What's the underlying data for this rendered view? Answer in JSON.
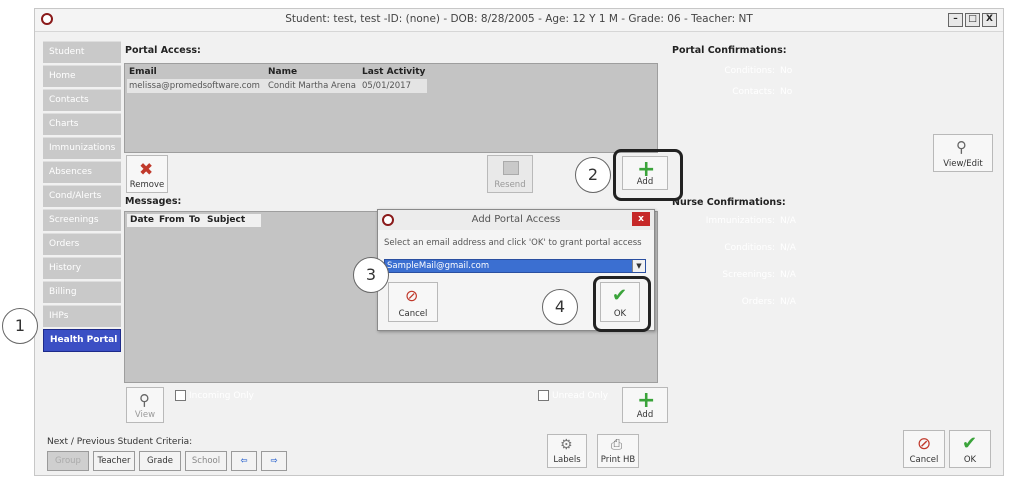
{
  "window": {
    "title": "Student: test, test -ID: (none) - DOB: 8/28/2005 - Age: 12 Y 1 M - Grade: 06 - Teacher: NT",
    "btn_min": "–",
    "btn_max": "□",
    "btn_close": "X"
  },
  "sidebar": {
    "items": [
      "Student",
      "Home",
      "Contacts",
      "Charts",
      "Immunizations",
      "Absences",
      "Cond/Alerts",
      "Screenings",
      "Orders",
      "History",
      "Billing",
      "IHPs",
      "Health Portal"
    ],
    "active_index": 12
  },
  "portal_access": {
    "header": "Portal Access:",
    "columns": [
      "Email",
      "Name",
      "Last Activity"
    ],
    "rows": [
      [
        "melissa@promedsoftware.com",
        "Condit Martha Arena",
        "05/01/2017"
      ]
    ],
    "remove_label": "Remove",
    "resend_label": "Resend",
    "add_label": "Add"
  },
  "messages": {
    "header": "Messages:",
    "columns": [
      "Date",
      "From",
      "To",
      "Subject"
    ],
    "view_label": "View",
    "incoming_only": "Incoming Only",
    "unread_only": "Unread Only",
    "add_label": "Add"
  },
  "portal_confirmations": {
    "header": "Portal Confirmations:",
    "items": [
      {
        "label": "Conditions:",
        "value": "No"
      },
      {
        "label": "Contacts:",
        "value": "No"
      }
    ],
    "view_edit_label": "View/Edit"
  },
  "nurse_confirmations": {
    "header": "Nurse Confirmations:",
    "items": [
      {
        "label": "Immunizations:",
        "value": "N/A"
      },
      {
        "label": "Conditions:",
        "value": "N/A"
      },
      {
        "label": "Screenings:",
        "value": "N/A"
      },
      {
        "label": "Orders:",
        "value": "N/A"
      }
    ]
  },
  "dialog": {
    "title": "Add Portal Access",
    "instruction": "Select an email address and click 'OK' to grant portal access",
    "email_value": "SampleMail@gmail.com",
    "cancel_label": "Cancel",
    "ok_label": "OK",
    "close_label": "x"
  },
  "callouts": [
    "1",
    "2",
    "3",
    "4"
  ],
  "footer": {
    "criteria_label": "Next / Previous Student Criteria:",
    "buttons": [
      "Group",
      "Teacher",
      "Grade",
      "School"
    ],
    "labels_label": "Labels",
    "print_label": "Print HB",
    "cancel_label": "Cancel",
    "ok_label": "OK"
  },
  "colors": {
    "active": "#3b4fc4",
    "add_green": "#3aa33a",
    "remove_red": "#c0392b",
    "dialog_title_red": "#c62828"
  }
}
